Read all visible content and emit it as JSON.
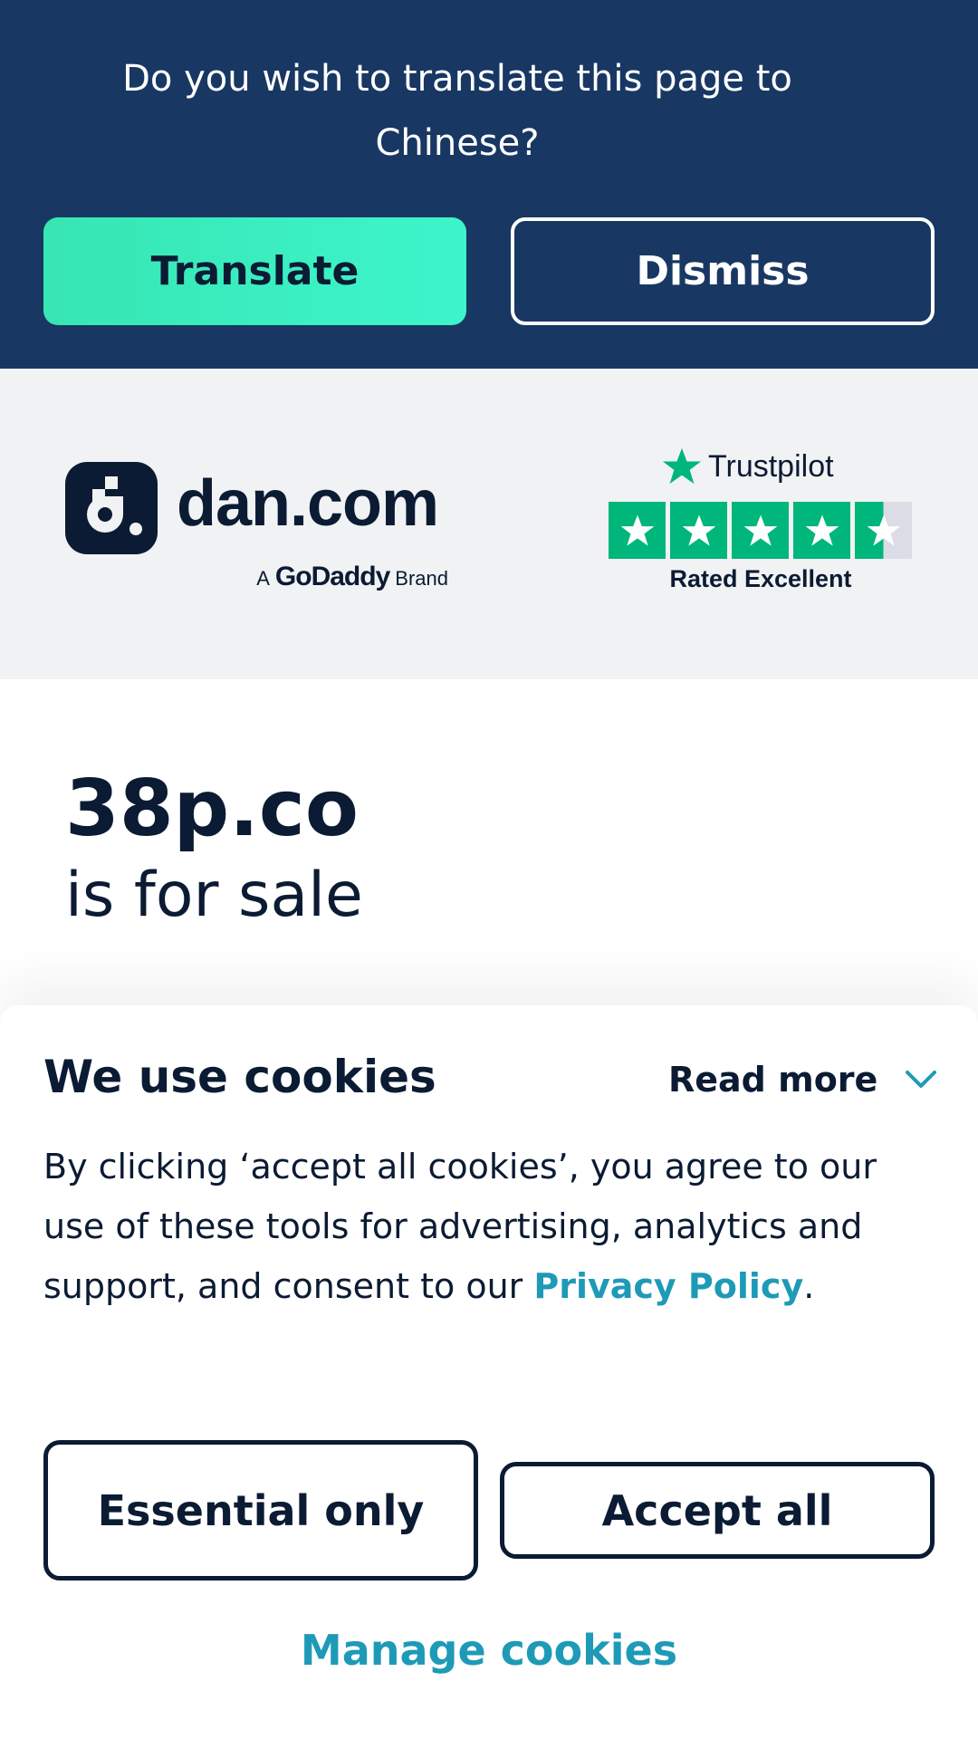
{
  "translate_banner": {
    "question": "Do you wish to translate this page to Chinese?",
    "translate_label": "Translate",
    "dismiss_label": "Dismiss"
  },
  "brand": {
    "logo_text": "dan.com",
    "sub_prefix": "A",
    "sub_brand": "GoDaddy",
    "sub_suffix": "Brand",
    "trustpilot_name": "Trustpilot",
    "trustpilot_rating_text": "Rated Excellent",
    "trustpilot_stars": 4.5,
    "colors": {
      "trustpilot_green": "#00b67a",
      "navy": "#0b1b33"
    }
  },
  "listing": {
    "domain": "38p.co",
    "status": "is for sale"
  },
  "cookies": {
    "title": "We use cookies",
    "read_more_label": "Read more",
    "body_text": "By clicking ‘accept all cookies’, you agree to our use of these tools for advertising, analytics and support, and consent to our ",
    "privacy_link": "Privacy Policy",
    "body_end": ".",
    "essential_label": "Essential only",
    "accept_label": "Accept all",
    "manage_label": "Manage cookies",
    "colors": {
      "link": "#1e9ab7"
    }
  }
}
